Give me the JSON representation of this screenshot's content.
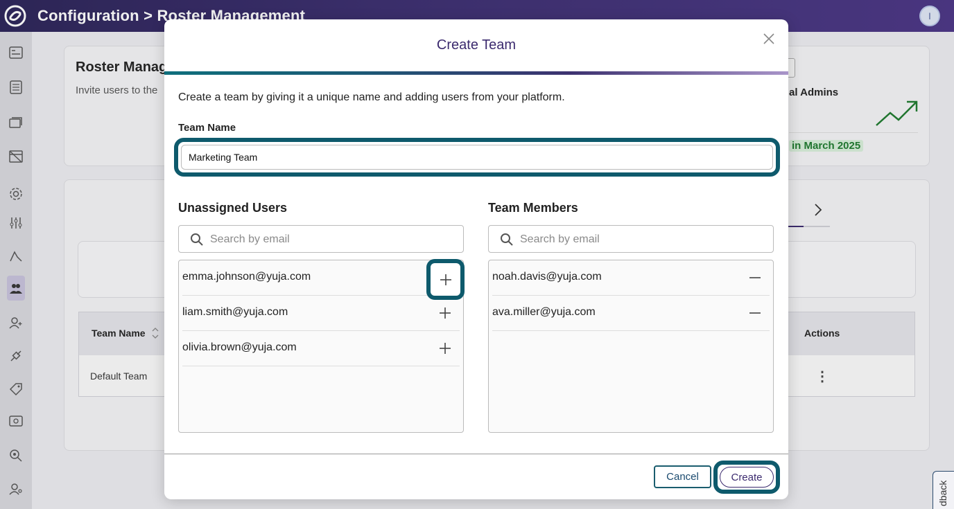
{
  "header": {
    "breadcrumb": "Configuration > Roster Management",
    "avatar_initial": "I"
  },
  "background": {
    "page_title": "Roster Manag",
    "page_subtitle": "Invite users to the",
    "admins_label": "al Admins",
    "march_badge": "in March 2025",
    "table": {
      "col_team_name": "Team Name",
      "col_actions": "Actions",
      "row_team": "Default Team",
      "row_actions_icon": "⋮"
    },
    "feedback_label": "dback"
  },
  "modal": {
    "title": "Create Team",
    "description": "Create a team by giving it a unique name and adding users from your platform.",
    "team_name_label": "Team Name",
    "team_name_value": "Marketing Team",
    "unassigned": {
      "title": "Unassigned Users",
      "search_placeholder": "Search by email",
      "users": [
        "emma.johnson@yuja.com",
        "liam.smith@yuja.com",
        "olivia.brown@yuja.com"
      ]
    },
    "members": {
      "title": "Team Members",
      "search_placeholder": "Search by email",
      "users": [
        "noah.davis@yuja.com",
        "ava.miller@yuja.com"
      ]
    },
    "cancel_label": "Cancel",
    "create_label": "Create"
  },
  "colors": {
    "accent_teal": "#0e5a6c",
    "brand_purple": "#3b2a6e",
    "trend_green": "#1e7a2e"
  },
  "icons": {
    "logo": "yuja-logo-icon",
    "close": "close-icon",
    "search": "search-icon",
    "add": "plus-icon",
    "remove": "minus-icon"
  }
}
